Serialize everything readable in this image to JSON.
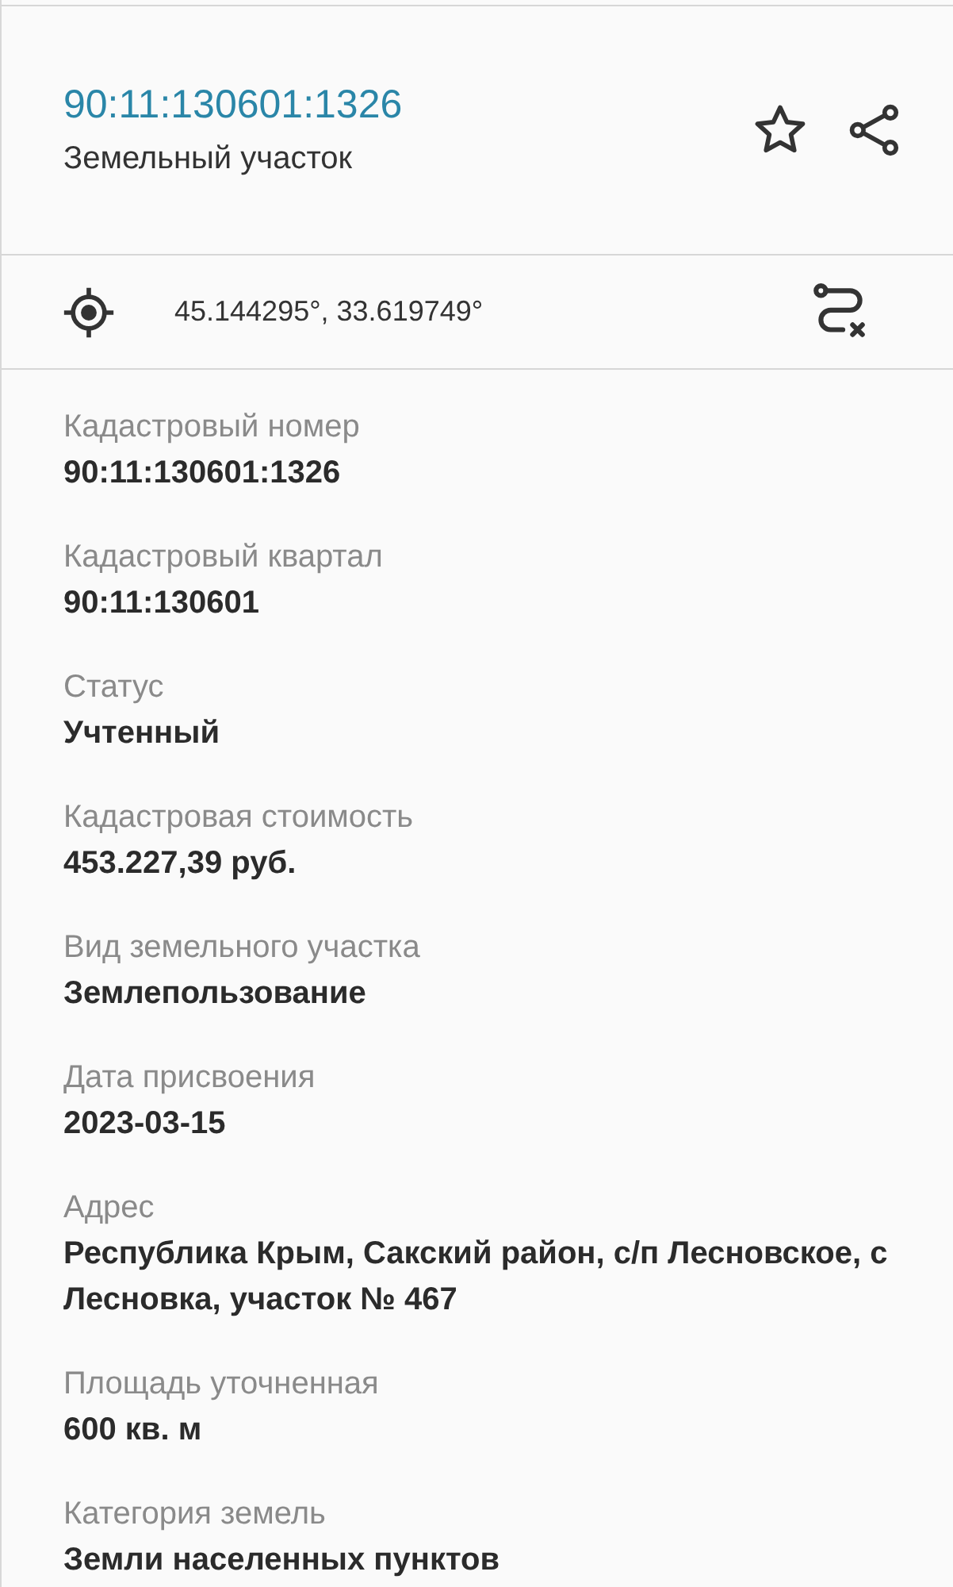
{
  "header": {
    "title": "90:11:130601:1326",
    "subtitle": "Земельный участок",
    "favorite": false
  },
  "coordinates": {
    "text": "45.144295°, 33.619749°"
  },
  "fields": [
    {
      "label": "Кадастровый номер",
      "value": "90:11:130601:1326"
    },
    {
      "label": "Кадастровый квартал",
      "value": "90:11:130601"
    },
    {
      "label": "Статус",
      "value": "Учтенный"
    },
    {
      "label": "Кадастровая стоимость",
      "value": "453.227,39 руб."
    },
    {
      "label": "Вид земельного участка",
      "value": "Землепользование"
    },
    {
      "label": "Дата присвоения",
      "value": "2023-03-15"
    },
    {
      "label": "Адрес",
      "value": "Республика Крым, Сакский район, с/п Лесновское, с Лесновка, участок № 467"
    },
    {
      "label": "Площадь уточненная",
      "value": "600 кв. м"
    },
    {
      "label": "Категория земель",
      "value": "Земли населенных пунктов"
    }
  ]
}
